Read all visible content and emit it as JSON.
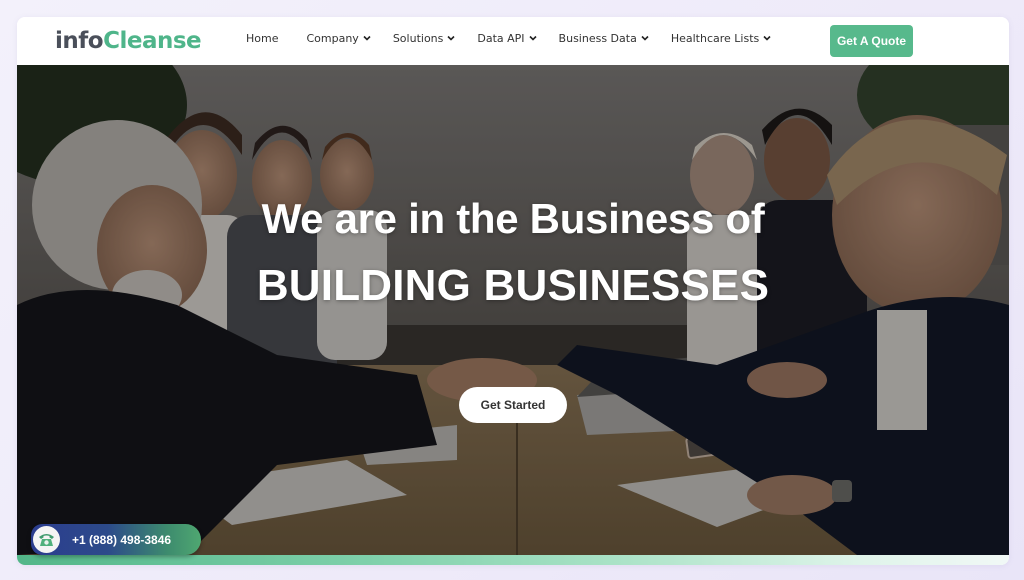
{
  "brand": {
    "logo_part1": "info",
    "logo_part2": "Cleanse",
    "accent_color": "#57b98c",
    "text_color": "#4a4f5a"
  },
  "nav": {
    "items": [
      {
        "label": "Home",
        "has_dropdown": false
      },
      {
        "label": "Company",
        "has_dropdown": true
      },
      {
        "label": "Solutions",
        "has_dropdown": true
      },
      {
        "label": "Data API",
        "has_dropdown": true
      },
      {
        "label": "Business Data",
        "has_dropdown": true
      },
      {
        "label": "Healthcare Lists",
        "has_dropdown": true
      }
    ],
    "cta_label": "Get A Quote"
  },
  "hero": {
    "headline_line1": "We are in the Business of",
    "headline_line2": "BUILDING BUSINESSES",
    "cta_label": "Get Started",
    "image_description": "business people shaking hands at a meeting table"
  },
  "contact": {
    "phone": "+1 (888) 498-3846",
    "icon": "telephone-icon"
  }
}
